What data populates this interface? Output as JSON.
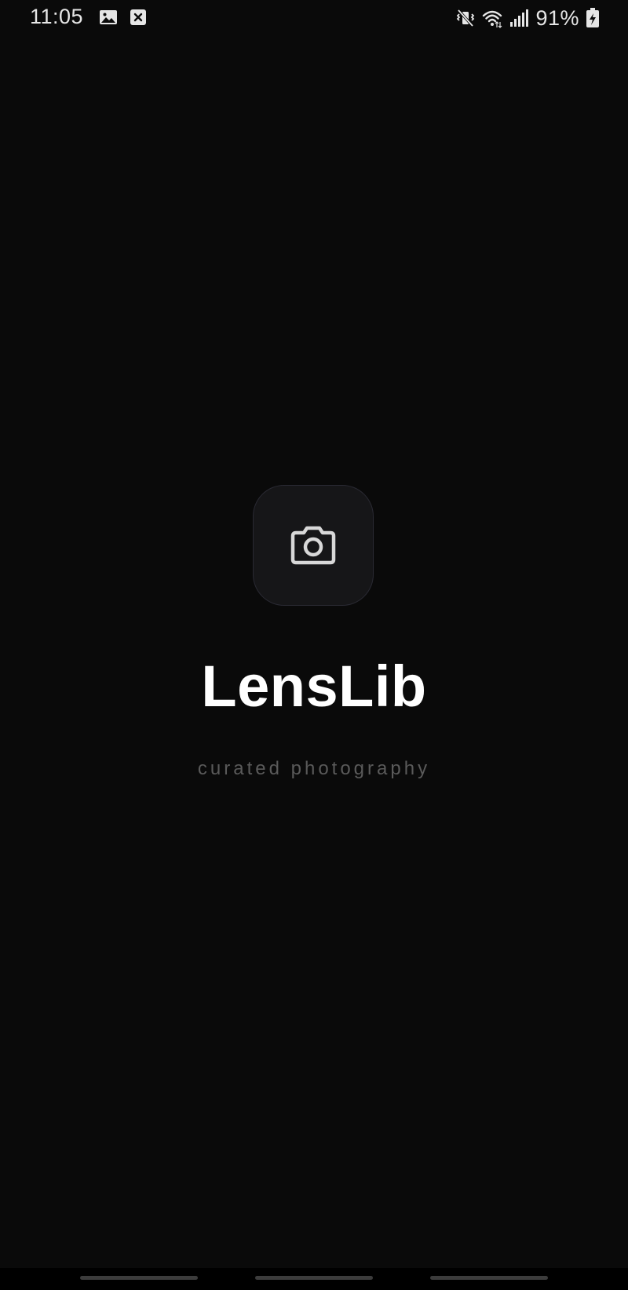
{
  "status_bar": {
    "time": "11:05",
    "battery_percent": "91%",
    "icons": {
      "gallery": "gallery-notification-icon",
      "close": "close-box-notification-icon",
      "mute": "vibrate-mute-icon",
      "wifi": "wifi-icon",
      "signal": "cell-signal-icon",
      "battery": "battery-charging-icon"
    }
  },
  "splash": {
    "icon": "camera-icon",
    "title": "LensLib",
    "tagline": "curated photography"
  },
  "colors": {
    "background": "#0a0a0a",
    "tile": "#161618",
    "tile_border": "#2a2a33",
    "title": "#ffffff",
    "tagline": "#5a5a5a",
    "icon_stroke": "#d8d8d8"
  }
}
